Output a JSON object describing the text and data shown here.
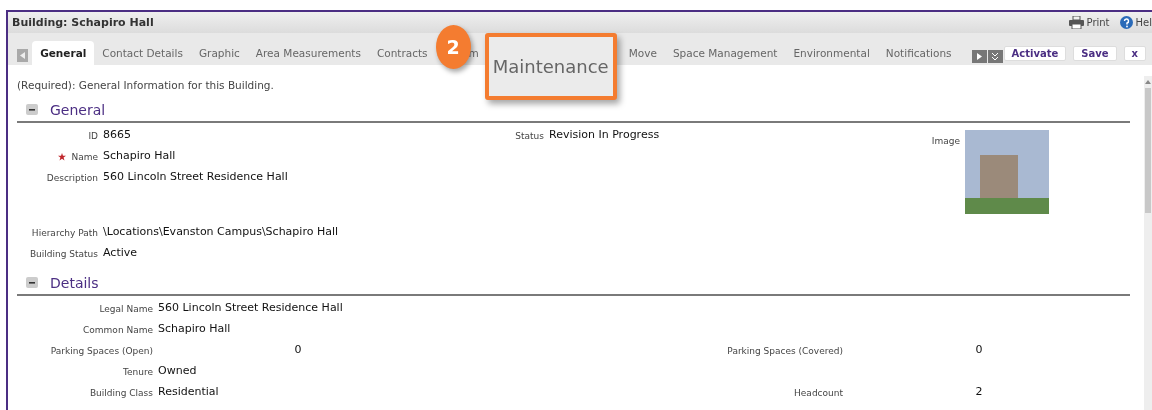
{
  "window": {
    "title": "Building: Schapiro Hall"
  },
  "header_actions": [
    {
      "kind": "print",
      "label": "Print"
    },
    {
      "kind": "help",
      "label": "Hel"
    }
  ],
  "tabs": [
    {
      "label": "General",
      "selected": true
    },
    {
      "label": "Contact Details",
      "selected": false
    },
    {
      "label": "Graphic",
      "selected": false
    },
    {
      "label": "Area Measurements",
      "selected": false
    },
    {
      "label": "Contracts",
      "selected": false
    },
    {
      "label": "m",
      "selected": false
    },
    {
      "label": "Move",
      "selected": false
    },
    {
      "label": "Space Management",
      "selected": false
    },
    {
      "label": "Environmental",
      "selected": false
    },
    {
      "label": "Notifications",
      "selected": false
    }
  ],
  "callout": {
    "number": "2",
    "label": "Maintenance"
  },
  "actions": [
    "Activate",
    "Save",
    "x"
  ],
  "intro": "(Required): General Information for this Building.",
  "sections": [
    {
      "kind": "general",
      "title": "General",
      "expanded": true,
      "rows": [
        {
          "fields": [
            {
              "label": "ID",
              "value": "8665"
            },
            {
              "label": "Status",
              "value": "Revision In Progress"
            }
          ]
        },
        {
          "fields": [
            {
              "label": "Name",
              "value": "Schapiro Hall",
              "required": true
            }
          ]
        },
        {
          "fields": [
            {
              "label": "Description",
              "value": "560 Lincoln Street Residence Hall"
            }
          ],
          "tall": true
        },
        {
          "fields": [
            {
              "label": "Hierarchy Path",
              "value": "\\Locations\\Evanston Campus\\Schapiro Hall"
            }
          ]
        },
        {
          "fields": [
            {
              "label": "Building Status",
              "value": "Active"
            }
          ]
        }
      ],
      "image": {
        "label": "Image"
      }
    },
    {
      "kind": "details",
      "title": "Details",
      "expanded": true,
      "rows": [
        {
          "fields": [
            {
              "label": "Legal Name",
              "value": "560 Lincoln Street Residence Hall"
            }
          ]
        },
        {
          "fields": [
            {
              "label": "Common Name",
              "value": "Schapiro Hall"
            }
          ]
        },
        {
          "fields": [
            {
              "label": "Parking Spaces (Open)",
              "value": "0",
              "numeric": true
            },
            {
              "label": "Parking Spaces (Covered)",
              "value": "0",
              "numeric": true
            }
          ]
        },
        {
          "fields": [
            {
              "label": "Tenure",
              "value": "Owned"
            }
          ]
        },
        {
          "fields": [
            {
              "label": "Building Class",
              "value": "Residential"
            },
            {
              "label": "Headcount",
              "value": "2",
              "numeric": true
            }
          ]
        }
      ]
    }
  ]
}
